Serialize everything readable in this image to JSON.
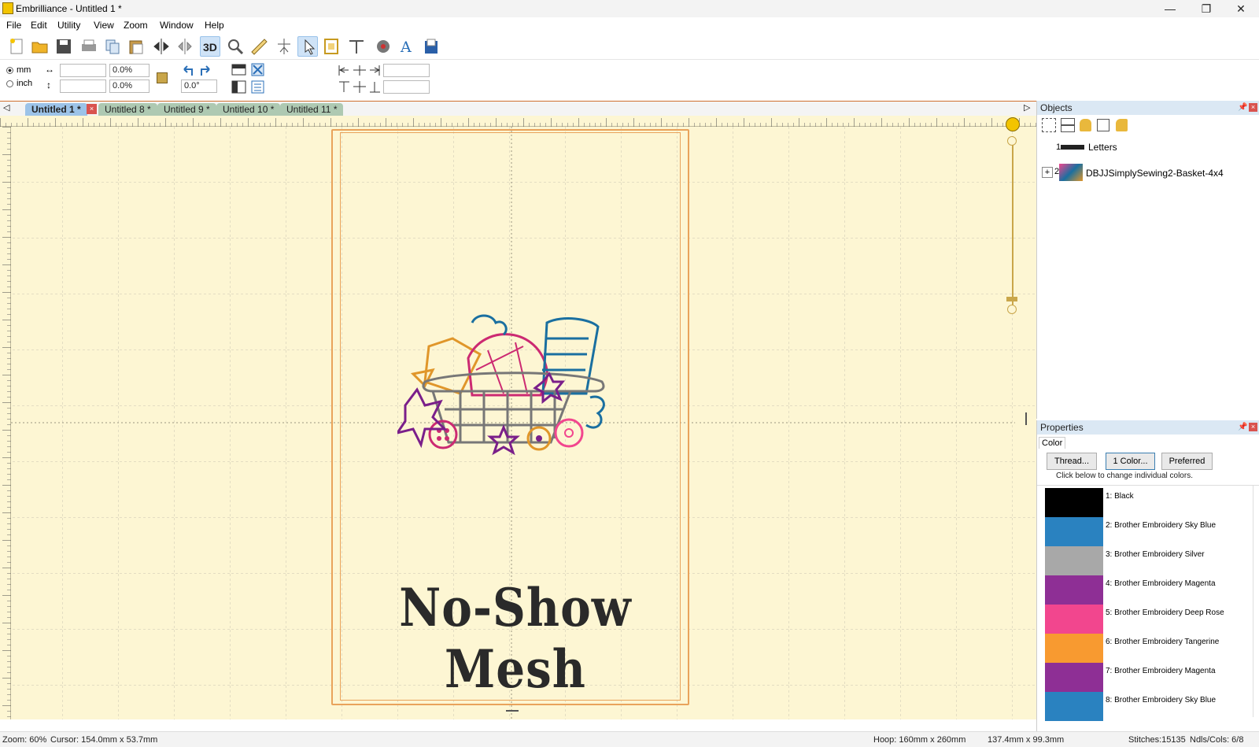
{
  "window": {
    "title": "Embrilliance - Untitled 1 *",
    "minimize": "—",
    "restore": "❐",
    "close": "✕"
  },
  "menu": [
    "File",
    "Edit",
    "Utility",
    "View",
    "Zoom",
    "Window",
    "Help"
  ],
  "toolbar2": {
    "units": {
      "mm": "mm",
      "inch": "inch",
      "selected": "mm"
    },
    "width_value": "",
    "width_pct": "0.0%",
    "height_value": "",
    "height_pct": "0.0%",
    "rotation": "0.0°",
    "align_value_1": "",
    "align_value_2": ""
  },
  "tabs": [
    "Untitled 1 *",
    "Untitled 8 *",
    "Untitled 9 *",
    "Untitled 10 *",
    "Untitled 11 *"
  ],
  "design": {
    "text": "No-Show Mesh"
  },
  "objects": {
    "title": "Objects",
    "items": [
      {
        "index": "1",
        "label": "Letters"
      },
      {
        "index": "2",
        "label": "DBJJSimplySewing2-Basket-4x4"
      }
    ]
  },
  "properties": {
    "title": "Properties",
    "tab": "Color",
    "buttons": {
      "thread": "Thread...",
      "one_color": "1 Color...",
      "preferred": "Preferred"
    },
    "hint": "Click below to change individual colors.",
    "colors": [
      {
        "label": "1: Black",
        "hex": "#000000"
      },
      {
        "label": "2: Brother Embroidery Sky Blue",
        "hex": "#2a82c0"
      },
      {
        "label": "3: Brother Embroidery Silver",
        "hex": "#a8a8a8"
      },
      {
        "label": "4: Brother Embroidery Magenta",
        "hex": "#8e2f95"
      },
      {
        "label": "5: Brother Embroidery Deep Rose",
        "hex": "#f2468e"
      },
      {
        "label": "6: Brother Embroidery Tangerine",
        "hex": "#f89a30"
      },
      {
        "label": "7: Brother Embroidery Magenta",
        "hex": "#8e2f95"
      },
      {
        "label": "8: Brother Embroidery Sky Blue",
        "hex": "#2a82c0"
      }
    ]
  },
  "status": {
    "zoom": "Zoom: 60%",
    "cursor": "Cursor: 154.0mm x 53.7mm",
    "hoop": "Hoop: 160mm x 260mm",
    "size": "137.4mm x 99.3mm",
    "stitches": "Stitches:15135",
    "ndls": "Ndls/Cols: 6/8"
  }
}
